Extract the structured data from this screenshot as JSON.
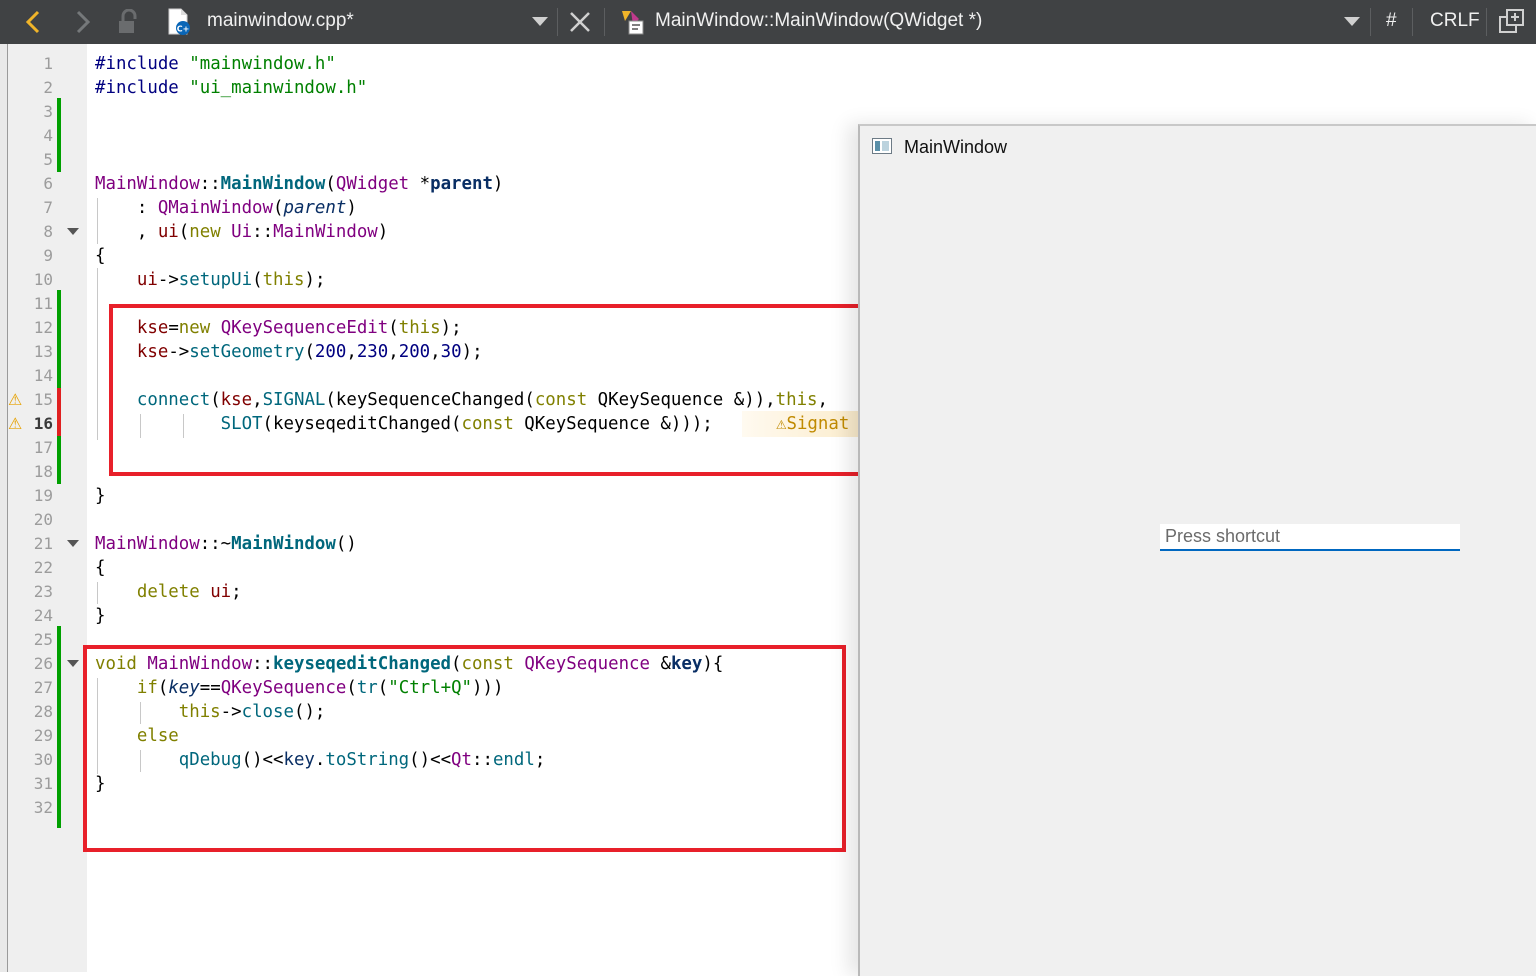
{
  "toolbar": {
    "file_name": "mainwindow.cpp*",
    "function_name": "MainWindow::MainWindow(QWidget *)",
    "hash_label": "#",
    "line_ending": "CRLF"
  },
  "editor": {
    "line_numbers": [
      "1",
      "2",
      "3",
      "4",
      "5",
      "6",
      "7",
      "8",
      "9",
      "10",
      "11",
      "12",
      "13",
      "14",
      "15",
      "16",
      "17",
      "18",
      "19",
      "20",
      "21",
      "22",
      "23",
      "24",
      "25",
      "26",
      "27",
      "28",
      "29",
      "30",
      "31",
      "32"
    ],
    "current_line": "16",
    "warning_marker": "⚠",
    "inline_hint": "Signat"
  },
  "app_window": {
    "title": "MainWindow",
    "key_sequence_placeholder": "Press shortcut"
  },
  "colors": {
    "toolbar_bg": "#404244",
    "added_line_marker": "#00a000",
    "modified_line_marker": "#e02020",
    "highlight_box": "#e8202a",
    "warning": "#e6a100",
    "keyword": "#808000",
    "type": "#800080",
    "function": "#00677c",
    "string": "#008000",
    "number": "#000080"
  }
}
